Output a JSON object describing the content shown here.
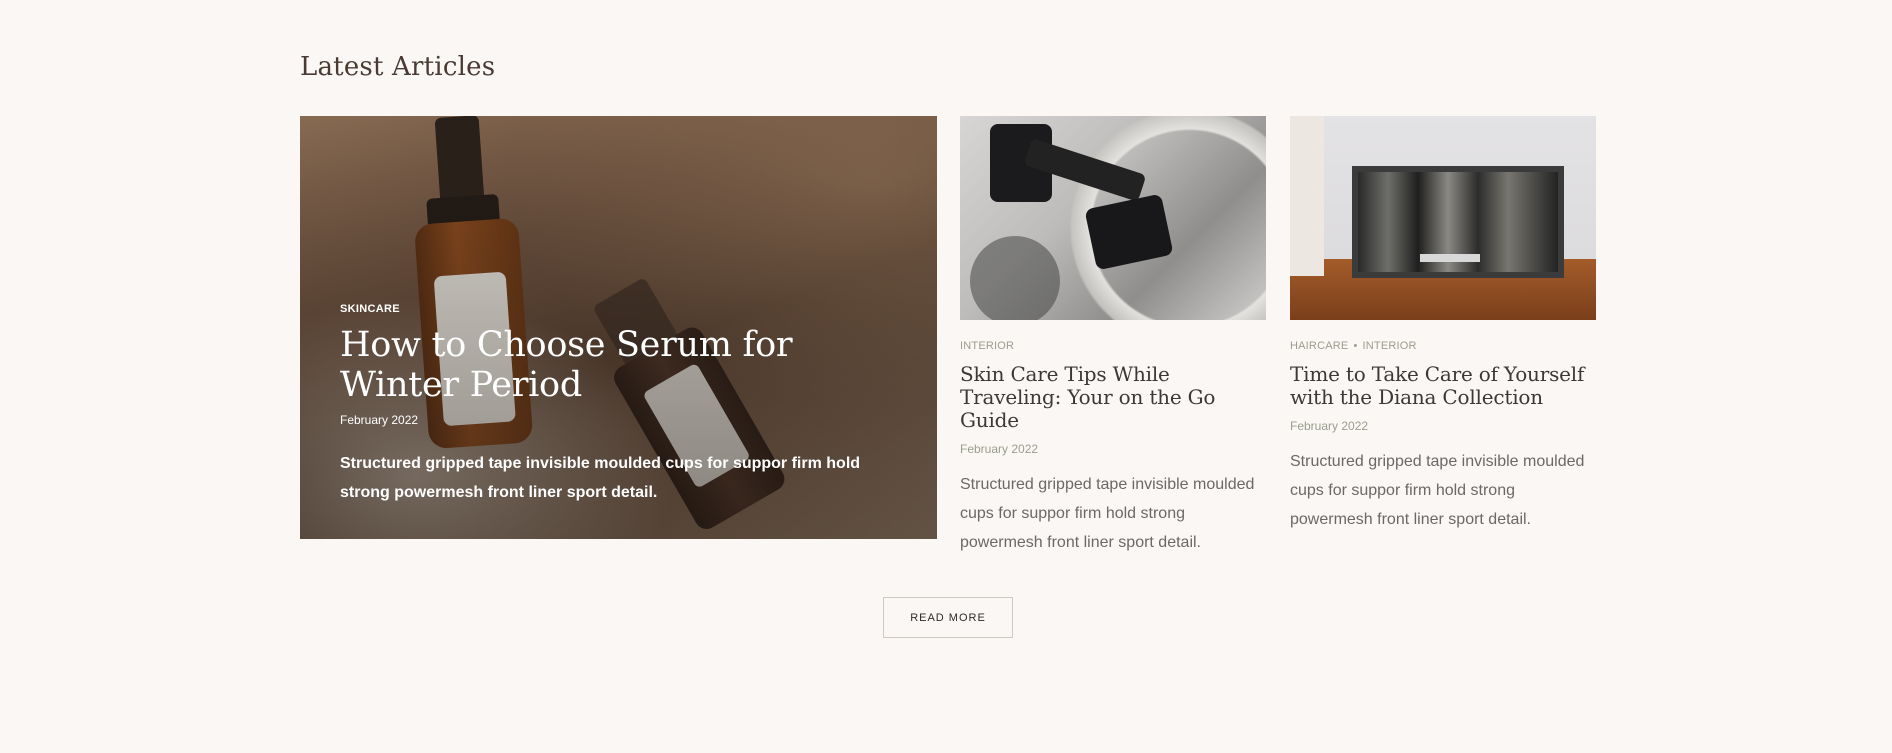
{
  "section": {
    "title": "Latest Articles"
  },
  "featured": {
    "category": "SKINCARE",
    "title": "How to Choose Serum for Winter Period",
    "date": "February 2022",
    "excerpt": "Structured gripped tape invisible moulded cups for suppor firm hold strong powermesh front liner sport detail."
  },
  "cards": [
    {
      "categories": [
        "INTERIOR"
      ],
      "title": "Skin Care Tips While Traveling: Your on the Go Guide",
      "date": "February 2022",
      "excerpt": "Structured gripped tape invisible moulded cups for suppor firm hold strong powermesh front liner sport detail."
    },
    {
      "categories": [
        "HAIRCARE",
        "INTERIOR"
      ],
      "title": "Time to Take Care of Yourself with the Diana Collection",
      "date": "February 2022",
      "excerpt": "Structured gripped tape invisible moulded cups for suppor firm hold strong powermesh front liner sport detail."
    }
  ],
  "read_more_label": "READ MORE",
  "colors": {
    "background": "#faf7f4",
    "meta": "#9a9d8e",
    "heading": "#4a3a34"
  }
}
